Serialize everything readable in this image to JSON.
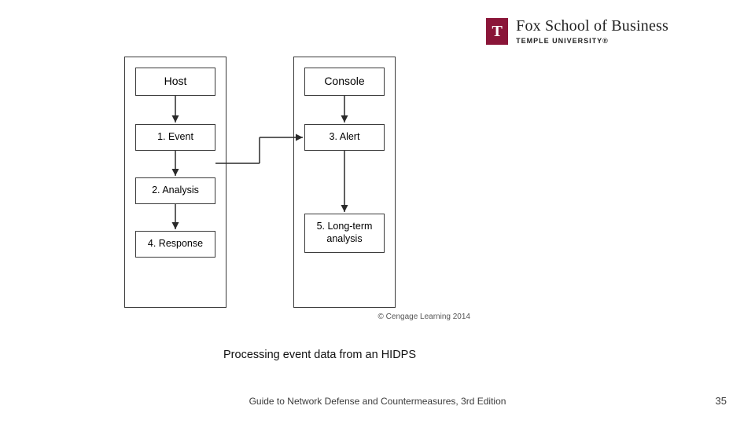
{
  "logo": {
    "mark_letter": "T",
    "line1": "Fox School of Business",
    "line2": "TEMPLE UNIVERSITY®"
  },
  "diagram": {
    "left": {
      "host": "Host",
      "event": "1. Event",
      "analysis": "2. Analysis",
      "response": "4. Response"
    },
    "right": {
      "console": "Console",
      "alert": "3. Alert",
      "longterm": "5. Long-term analysis"
    },
    "copyright": "© Cengage Learning 2014"
  },
  "caption": "Processing event data from an HIDPS",
  "footer": "Guide to Network Defense and Countermeasures, 3rd Edition",
  "page_number": "35"
}
